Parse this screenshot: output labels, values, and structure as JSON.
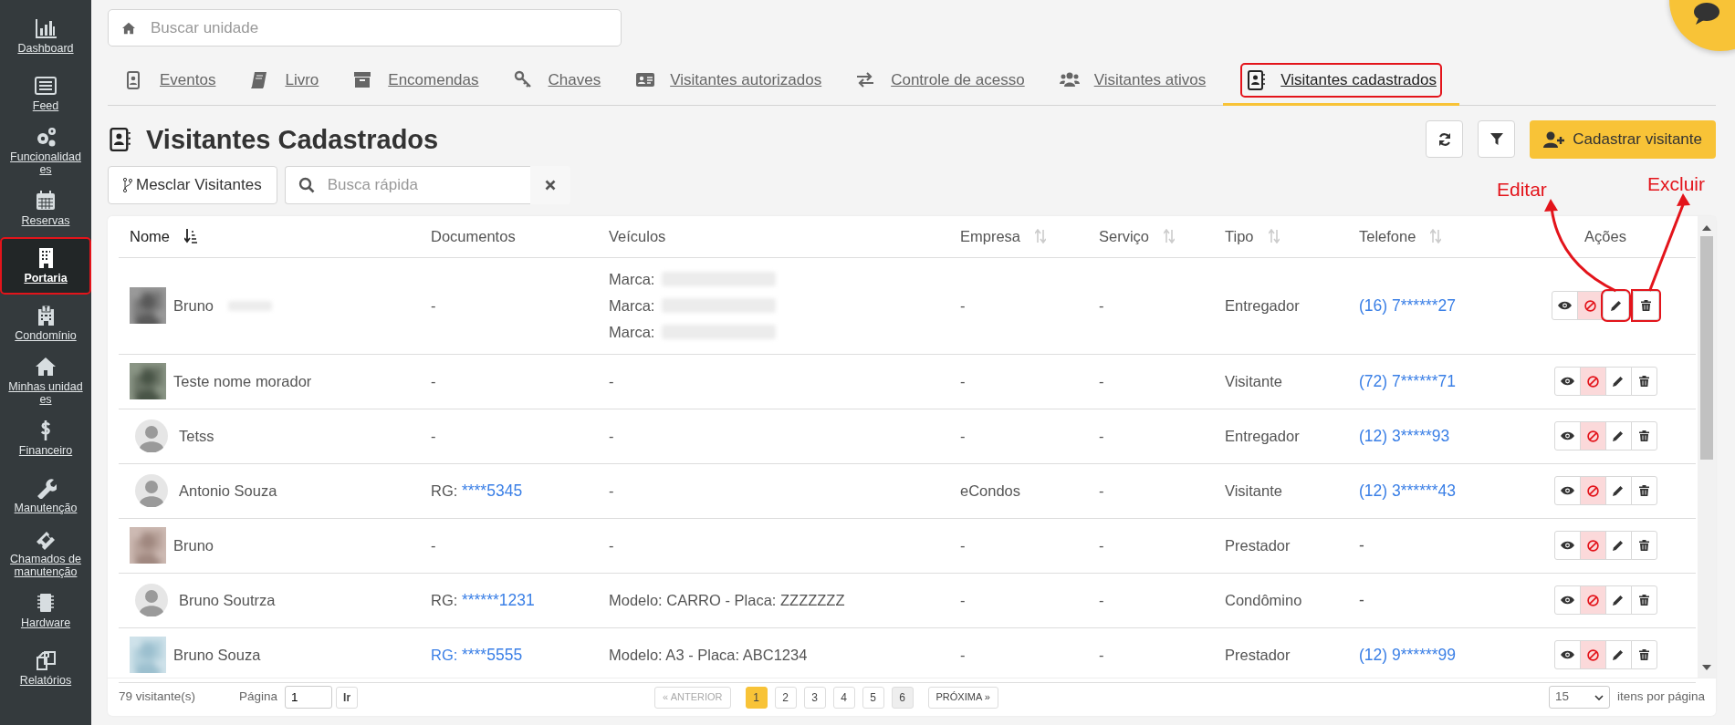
{
  "sidebar": {
    "items": [
      {
        "label": "Dashboard",
        "selected": false,
        "highlighted": false
      },
      {
        "label": "Feed",
        "selected": false,
        "highlighted": false
      },
      {
        "label": "Funcionalidades",
        "selected": false,
        "highlighted": false
      },
      {
        "label": "Reservas",
        "selected": false,
        "highlighted": false
      },
      {
        "label": "Portaria",
        "selected": true,
        "highlighted": true
      },
      {
        "label": "Condomínio",
        "selected": false,
        "highlighted": false
      },
      {
        "label": "Minhas unidades",
        "selected": false,
        "highlighted": false
      },
      {
        "label": "Financeiro",
        "selected": false,
        "highlighted": false
      },
      {
        "label": "Manutenção",
        "selected": false,
        "highlighted": false
      },
      {
        "label": "Chamados de manutenção",
        "selected": false,
        "highlighted": false
      },
      {
        "label": "Hardware",
        "selected": false,
        "highlighted": false
      },
      {
        "label": "Relatórios",
        "selected": false,
        "highlighted": false
      }
    ]
  },
  "unit_search": {
    "placeholder": "Buscar unidade"
  },
  "tabs": [
    {
      "label": "Eventos",
      "selected": false,
      "highlighted": false
    },
    {
      "label": "Livro",
      "selected": false,
      "highlighted": false
    },
    {
      "label": "Encomendas",
      "selected": false,
      "highlighted": false
    },
    {
      "label": "Chaves",
      "selected": false,
      "highlighted": false
    },
    {
      "label": "Visitantes autorizados",
      "selected": false,
      "highlighted": false
    },
    {
      "label": "Controle de acesso",
      "selected": false,
      "highlighted": false
    },
    {
      "label": "Visitantes ativos",
      "selected": false,
      "highlighted": false
    },
    {
      "label": "Visitantes cadastrados",
      "selected": true,
      "highlighted": true
    }
  ],
  "page": {
    "title": "Visitantes Cadastrados",
    "add_button": "Cadastrar visitante"
  },
  "toolbar": {
    "merge_button": "Mesclar Visitantes",
    "quick_search": {
      "placeholder": "Busca rápida"
    }
  },
  "table": {
    "columns": [
      {
        "label": "Nome",
        "sortable": true,
        "sorted": true
      },
      {
        "label": "Documentos",
        "sortable": false,
        "sorted": false
      },
      {
        "label": "Veículos",
        "sortable": false,
        "sorted": false
      },
      {
        "label": "Empresa",
        "sortable": true,
        "sorted": false
      },
      {
        "label": "Serviço",
        "sortable": true,
        "sorted": false
      },
      {
        "label": "Tipo",
        "sortable": true,
        "sorted": false
      },
      {
        "label": "Telefone",
        "sortable": true,
        "sorted": false
      },
      {
        "label": "Ações",
        "sortable": false,
        "sorted": false
      }
    ],
    "rows": [
      {
        "avatar": {
          "kind": "picture"
        },
        "name": "Bruno",
        "name_redacted": true,
        "document": "-",
        "vehicles": [
          {
            "text": "Marca:",
            "redacted": true
          },
          {
            "text": "Marca:",
            "redacted": true
          },
          {
            "text": "Marca:",
            "redacted": true
          }
        ],
        "company": "-",
        "service": "-",
        "type": "Entregador",
        "phone": "(16) 7******27",
        "phone_link": true,
        "actions_highlighted": true
      },
      {
        "avatar": {
          "kind": "picture"
        },
        "name": "Teste nome morador",
        "name_redacted": false,
        "document": "-",
        "vehicles": [
          {
            "text": "-",
            "redacted": false
          }
        ],
        "company": "-",
        "service": "-",
        "type": "Visitante",
        "phone": "(72) 7******71",
        "phone_link": true,
        "actions_highlighted": false
      },
      {
        "avatar": {
          "kind": "silhouette"
        },
        "name": "Tetss",
        "name_redacted": false,
        "document": "-",
        "vehicles": [
          {
            "text": "-",
            "redacted": false
          }
        ],
        "company": "-",
        "service": "-",
        "type": "Entregador",
        "phone": "(12) 3*****93",
        "phone_link": true,
        "actions_highlighted": false
      },
      {
        "avatar": {
          "kind": "silhouette"
        },
        "name": "Antonio Souza",
        "name_redacted": false,
        "document": {
          "label": "RG:",
          "value": "****5345",
          "label_link": false
        },
        "vehicles": [
          {
            "text": "-",
            "redacted": false
          }
        ],
        "company": "eCondos",
        "service": "-",
        "type": "Visitante",
        "phone": "(12) 3******43",
        "phone_link": true,
        "actions_highlighted": false
      },
      {
        "avatar": {
          "kind": "picture"
        },
        "name": "Bruno",
        "name_redacted": false,
        "document": "-",
        "vehicles": [
          {
            "text": "-",
            "redacted": false
          }
        ],
        "company": "-",
        "service": "-",
        "type": "Prestador",
        "phone": "-",
        "phone_link": false,
        "actions_highlighted": false
      },
      {
        "avatar": {
          "kind": "silhouette"
        },
        "name": "Bruno Soutrza",
        "name_redacted": false,
        "document": {
          "label": "RG:",
          "value": "******1231",
          "label_link": false
        },
        "vehicles": [
          {
            "text": "Modelo: CARRO - Placa: ZZZZZZZ",
            "redacted": false
          }
        ],
        "company": "-",
        "service": "-",
        "type": "Condômino",
        "phone": "-",
        "phone_link": false,
        "actions_highlighted": false
      },
      {
        "avatar": {
          "kind": "picture"
        },
        "name": "Bruno Souza",
        "name_redacted": false,
        "document": {
          "label": "RG:",
          "value": "****5555",
          "label_link": true
        },
        "vehicles": [
          {
            "text": "Modelo: A3 - Placa: ABC1234",
            "redacted": false
          }
        ],
        "company": "-",
        "service": "-",
        "type": "Prestador",
        "phone": "(12) 9******99",
        "phone_link": true,
        "actions_highlighted": false
      }
    ]
  },
  "footer": {
    "count": "79 visitante(s)",
    "page_label": "Página",
    "page_value": "1",
    "go_button": "Ir",
    "prev": "« ANTERIOR",
    "prev_disabled": true,
    "pages": [
      {
        "label": "1",
        "selected": true,
        "hovered": false
      },
      {
        "label": "2",
        "selected": false,
        "hovered": false
      },
      {
        "label": "3",
        "selected": false,
        "hovered": false
      },
      {
        "label": "4",
        "selected": false,
        "hovered": false
      },
      {
        "label": "5",
        "selected": false,
        "hovered": false
      },
      {
        "label": "6",
        "selected": false,
        "hovered": true
      }
    ],
    "next": "PRÓXIMA »",
    "per_page": "15",
    "per_page_label": "itens por página"
  },
  "annotations": [
    {
      "kind": "edit",
      "text": "Editar"
    },
    {
      "kind": "delete",
      "text": "Excluir"
    }
  ]
}
